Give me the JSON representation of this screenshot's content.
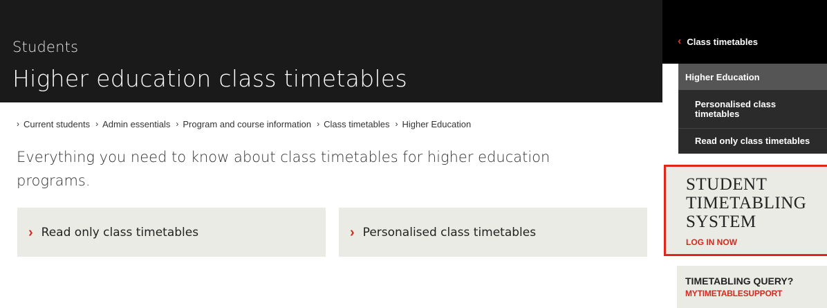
{
  "header": {
    "kicker": "Students",
    "title": "Higher education class timetables"
  },
  "breadcrumb": {
    "separator": "›",
    "items": [
      "Current students",
      "Admin essentials",
      "Program and course information",
      "Class timetables",
      "Higher Education"
    ]
  },
  "intro": "Everything you need to know about class timetables for higher education programs.",
  "tiles": [
    {
      "label": "Read only class timetables",
      "icon": "chevron-right-icon"
    },
    {
      "label": "Personalised class timetables",
      "icon": "chevron-right-icon"
    }
  ],
  "sidebar": {
    "back_label": "Class timetables",
    "back_icon": "chevron-left-icon",
    "section": "Higher Education",
    "items": [
      "Personalised class timetables",
      "Read only class timetables"
    ]
  },
  "promo": {
    "title_lines": [
      "STUDENT",
      "TIMETABLING",
      "SYSTEM"
    ],
    "cta": "LOG IN NOW"
  },
  "query": {
    "title": "TIMETABLING QUERY?",
    "link": "MYTIMETABLESUPPORT"
  },
  "colors": {
    "accent": "#d42a1e",
    "header_bg": "#1a1a1a",
    "tile_bg": "#ebebe6"
  }
}
